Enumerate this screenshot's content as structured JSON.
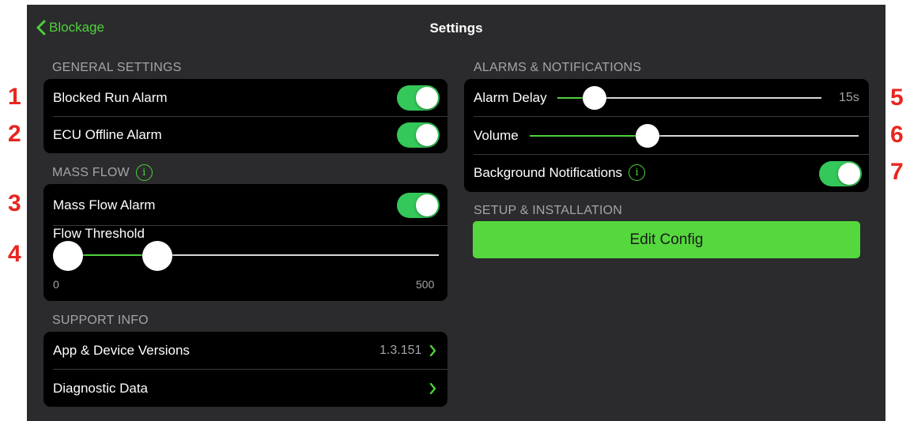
{
  "nav": {
    "back_label": "Blockage",
    "title": "Settings"
  },
  "general": {
    "header": "GENERAL SETTINGS",
    "blocked_run_label": "Blocked Run Alarm",
    "blocked_run_on": true,
    "ecu_offline_label": "ECU Offline Alarm",
    "ecu_offline_on": true
  },
  "mass_flow": {
    "header": "MASS FLOW",
    "alarm_label": "Mass Flow Alarm",
    "alarm_on": true,
    "threshold_label": "Flow Threshold",
    "min_label": "0",
    "max_label": "500"
  },
  "support": {
    "header": "SUPPORT INFO",
    "versions_label": "App & Device Versions",
    "versions_value": "1.3.151",
    "diagnostic_label": "Diagnostic Data"
  },
  "alarms": {
    "header": "ALARMS & NOTIFICATIONS",
    "delay_label": "Alarm Delay",
    "delay_value": "15s",
    "volume_label": "Volume",
    "background_label": "Background Notifications",
    "background_on": true
  },
  "setup": {
    "header": "SETUP & INSTALLATION",
    "edit_config_label": "Edit Config"
  },
  "markers": [
    "1",
    "2",
    "3",
    "4",
    "5",
    "6",
    "7"
  ],
  "colors": {
    "accent": "#4ed13b",
    "toggle_on": "#34c759",
    "button": "#55d83e",
    "background": "#2b2b2d",
    "card": "#000000",
    "marker": "#e8261f"
  },
  "icons": {
    "back": "chevron-left-icon",
    "info": "info-circle-icon",
    "disclosure": "chevron-right-icon"
  }
}
